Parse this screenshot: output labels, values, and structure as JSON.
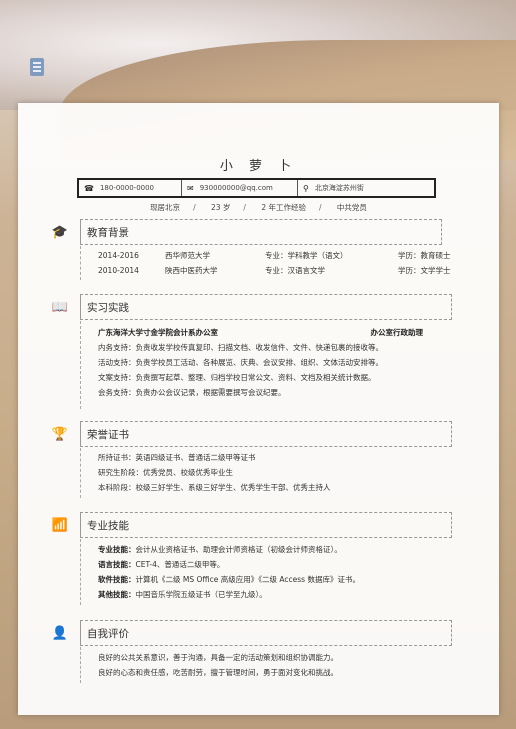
{
  "name": "小 萝 卜",
  "contact": {
    "phone": "180-0000-0000",
    "email": "930000000@qq.com",
    "address": "北京海淀苏州街"
  },
  "meta": [
    "现居北京",
    "23 岁",
    "2 年工作经验",
    "中共党员"
  ],
  "education": {
    "title": "教育背景",
    "rows": [
      {
        "period": "2014-2016",
        "school": "西华师范大学",
        "major": "专业：学科教学（语文）",
        "degree": "学历：教育硕士"
      },
      {
        "period": "2010-2014",
        "school": "陕西中医药大学",
        "major": "专业：汉语言文学",
        "degree": "学历：文学学士"
      }
    ]
  },
  "practice": {
    "title": "实习实践",
    "org": "广东海洋大学寸金学院会计系办公室",
    "role": "办公室行政助理",
    "lines": [
      "内务支持：负责收发学校传真复印、扫描文档、收发信件、文件、快递包裹的接收等。",
      "活动支持：负责学校员工活动、各种展览、庆典、会议安排、组织、文体活动安排等。",
      "文案支持：负责撰写起草、整理、归档学校日常公文、资料、文档及相关统计数据。",
      "会务支持：负责办公会议记录，根据需要撰写会议纪要。"
    ]
  },
  "honors": {
    "title": "荣誉证书",
    "lines": [
      "所持证书：英语四级证书、普通话二级甲等证书",
      "研究生阶段：优秀党员、校级优秀毕业生",
      "本科阶段：校级三好学生、系级三好学生、优秀学生干部、优秀主持人"
    ]
  },
  "skills": {
    "title": "专业技能",
    "items": [
      {
        "label": "专业技能：",
        "text": "会计从业资格证书、助理会计师资格证（初级会计师资格证）。"
      },
      {
        "label": "语言技能：",
        "text": "CET-4、普通话二级甲等。"
      },
      {
        "label": "软件技能：",
        "text": "计算机《二级 MS Office 高级应用》《二级 Access 数据库》证书。"
      },
      {
        "label": "其他技能：",
        "text": "中国音乐学院五级证书（已学至九级）。"
      }
    ]
  },
  "self": {
    "title": "自我评价",
    "lines": [
      "良好的公共关系意识，善于沟通，具备一定的活动策划和组织协调能力。",
      "良好的心态和责任感，吃苦耐劳，擅于管理时间，勇于面对变化和挑战。"
    ]
  }
}
